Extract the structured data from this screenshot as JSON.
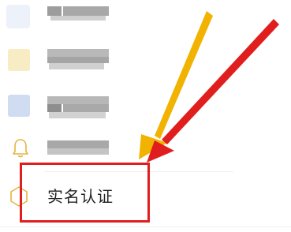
{
  "menu": {
    "items": [
      {
        "id": "item-1",
        "label": "",
        "blurred": true
      },
      {
        "id": "item-2",
        "label": "",
        "blurred": true
      },
      {
        "id": "item-3",
        "label": "",
        "blurred": true
      },
      {
        "id": "item-4",
        "label": "",
        "blurred": true,
        "icon": "bell-icon"
      },
      {
        "id": "item-5",
        "label": "实名认证",
        "blurred": false,
        "icon": "badge-icon"
      }
    ]
  },
  "annotations": {
    "highlight_color": "#e01e1e",
    "arrow_colors": [
      "#f2b200",
      "#e01e1e"
    ]
  },
  "colors": {
    "icon_blue": "#cfdcf2",
    "icon_yellow": "#f8ecc4",
    "icon_gold": "#e5b440",
    "blur_gray": "#b8b8b8"
  }
}
